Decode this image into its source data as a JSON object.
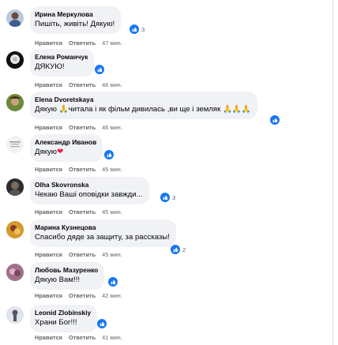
{
  "comments": [
    {
      "name": "Ирина Меркулова",
      "text": "Пишіть, живіть! Дякую!",
      "like": "Нравится",
      "reply": "Ответить",
      "time": "47 мин.",
      "count": "3"
    },
    {
      "name": "Елена Романчук",
      "text": "ДЯКУЮ!",
      "like": "Нравится",
      "reply": "Ответить",
      "time": "46 мин.",
      "count": ""
    },
    {
      "name": "Elena Dvoretskaya",
      "text": "Дякую 🙏читала і як фільм дивилась ,ви ще і земляк 🙏🙏🙏",
      "like": "Нравится",
      "reply": "Ответить",
      "time": "46 мин.",
      "count": ""
    },
    {
      "name": "Александр Иванов",
      "text": "Дякую",
      "like": "Нравится",
      "reply": "Ответить",
      "time": "45 мин.",
      "count": ""
    },
    {
      "name": "Olha Skovronska",
      "text": "Чекаю Ваші оповідки завжди...",
      "like": "Нравится",
      "reply": "Ответить",
      "time": "45 мин.",
      "count": "3"
    },
    {
      "name": "Марина Кузнецова",
      "text": "Спасибо дяде за защиту, за рассказы!",
      "like": "Нравится",
      "reply": "Ответить",
      "time": "45 мин.",
      "count": "2"
    },
    {
      "name": "Любовь Мазуренко",
      "text": "Дякую Вам!!!",
      "like": "Нравится",
      "reply": "Ответить",
      "time": "42 мин.",
      "count": ""
    },
    {
      "name": "Leonid Zlobinskiy",
      "text": "Храни Бог!!!",
      "like": "Нравится",
      "reply": "Ответить",
      "time": "41 мин.",
      "count": ""
    }
  ],
  "colors": {
    "like_blue": "#1877f2",
    "bubble": "#f0f2f5",
    "heart": "#e41e3f"
  },
  "icons": {
    "reaction": "like-icon",
    "heart": "heart-icon"
  }
}
